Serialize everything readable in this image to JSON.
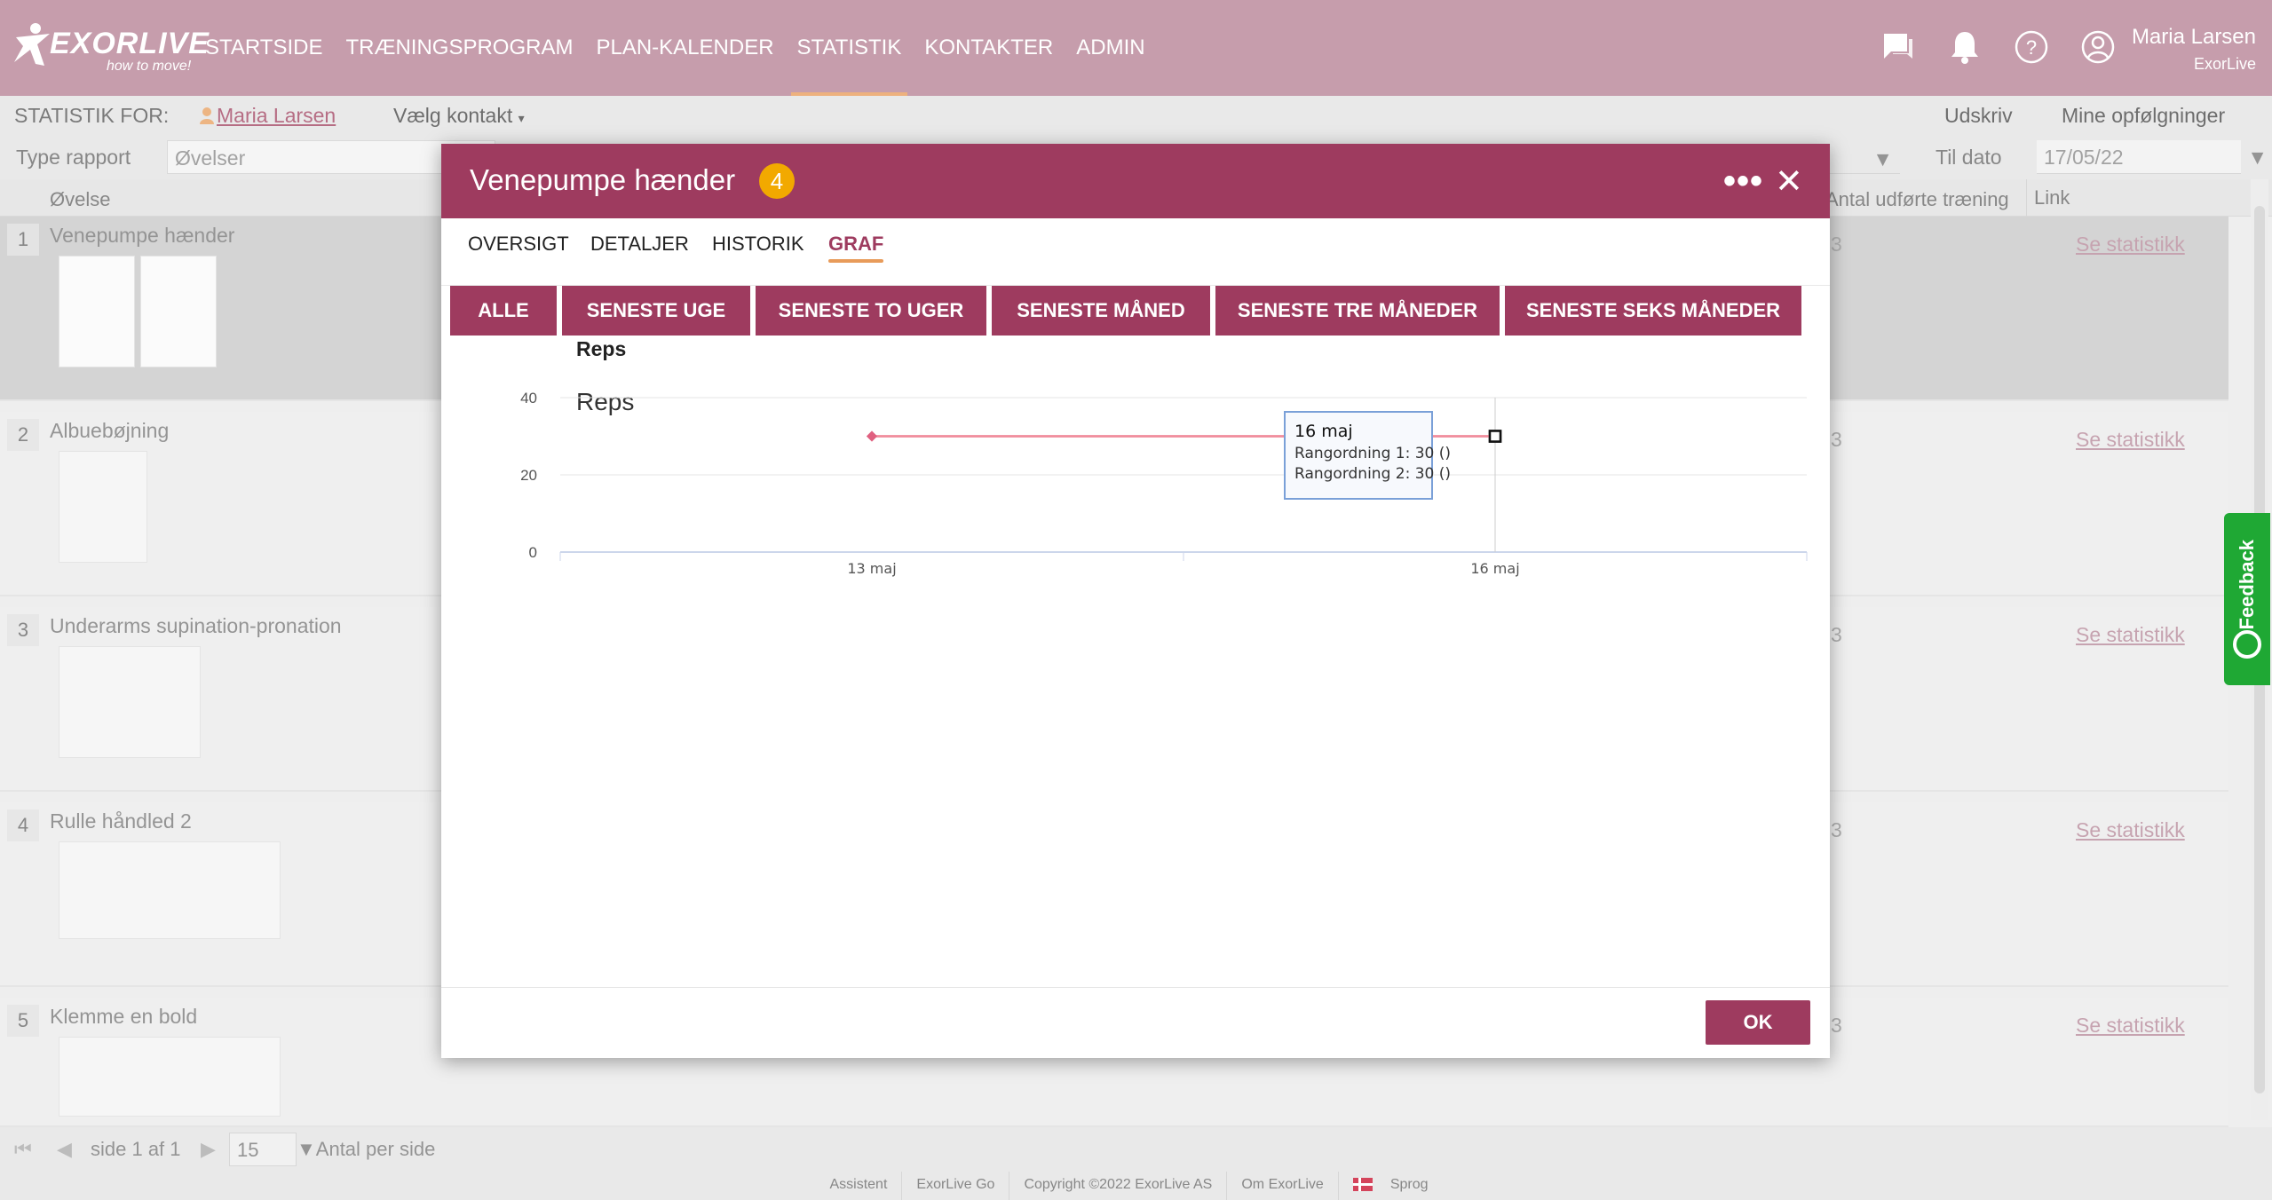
{
  "app": {
    "logo_word": "EXORLIVE",
    "logo_tagline": "how to move!"
  },
  "nav": {
    "items": [
      "STARTSIDE",
      "TRÆNINGSPROGRAM",
      "PLAN-KALENDER",
      "STATISTIK",
      "KONTAKTER",
      "ADMIN"
    ],
    "active": "STATISTIK"
  },
  "user": {
    "name": "Maria Larsen",
    "org": "ExorLive"
  },
  "statbar": {
    "label": "STATISTIK FOR:",
    "contact": "Maria Larsen",
    "choose_contact": "Vælg kontakt",
    "print": "Udskriv",
    "followups": "Mine opfølgninger"
  },
  "filters": {
    "type_label": "Type rapport",
    "type_value": "Øvelser",
    "to_date_label": "Til dato",
    "to_date_value": "17/05/22"
  },
  "table": {
    "headers": {
      "exercise": "Øvelse",
      "count": "Antal udførte træning",
      "link": "Link"
    },
    "rows": [
      {
        "num": "1",
        "name": "Venepumpe hænder",
        "count": "3",
        "link": "Se statistikk"
      },
      {
        "num": "2",
        "name": "Albuebøjning",
        "count": "3",
        "link": "Se statistikk"
      },
      {
        "num": "3",
        "name": "Underarms supination-pronation",
        "count": "3",
        "link": "Se statistikk"
      },
      {
        "num": "4",
        "name": "Rulle håndled 2",
        "count": "3",
        "link": "Se statistikk"
      },
      {
        "num": "5",
        "name": "Klemme en bold",
        "count": "3",
        "link": "Se statistikk"
      }
    ]
  },
  "pager": {
    "page_text": "side 1 af 1",
    "page_size": "15",
    "per_page_label": "Antal per side"
  },
  "footer": {
    "links": [
      "Assistent",
      "ExorLive Go",
      "Copyright ©2022 ExorLive AS",
      "Om ExorLive",
      "Sprog"
    ]
  },
  "feedback": {
    "label": "Feedback"
  },
  "modal": {
    "title": "Venepumpe hænder",
    "badge": "4",
    "tabs": [
      "OVERSIGT",
      "DETALJER",
      "HISTORIK",
      "GRAF"
    ],
    "active_tab": "GRAF",
    "periods": [
      "ALLE",
      "SENESTE UGE",
      "SENESTE TO UGER",
      "SENESTE MÅNED",
      "SENESTE TRE MÅNEDER",
      "SENESTE SEKS MÅNEDER"
    ],
    "section_title": "Reps",
    "ok_label": "OK"
  },
  "chart_data": {
    "type": "line",
    "title": "Reps",
    "x": [
      "13 maj",
      "16 maj"
    ],
    "series": [
      {
        "name": "Rangordning 1",
        "values": [
          30,
          30
        ]
      },
      {
        "name": "Rangordning 2",
        "values": [
          30,
          30
        ]
      }
    ],
    "ylim": [
      0,
      40
    ],
    "yticks": [
      0,
      20,
      40
    ],
    "grid": true,
    "colors": {
      "line": "#f08c9b",
      "marker": "#e06080"
    },
    "tooltip": {
      "title": "16 maj",
      "lines": [
        "Rangordning 1: 30 ()",
        "Rangordning 2: 30 ()"
      ]
    }
  },
  "colors": {
    "nav_bg": "#b68295",
    "brand": "#9e3b5f",
    "accent": "#e89b5a",
    "badge": "#f2a900",
    "feedback": "#1fa834"
  }
}
